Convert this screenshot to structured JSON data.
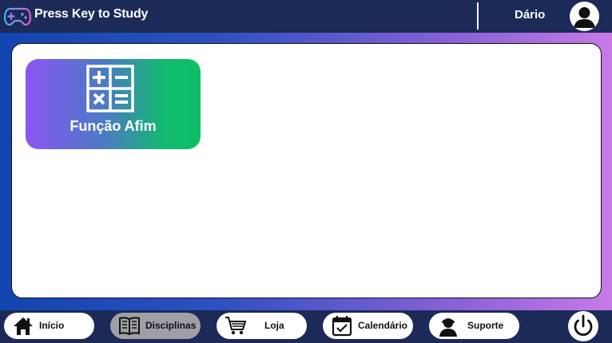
{
  "header": {
    "app_title": "Press Key to Study",
    "logo_icon": "gamepad-icon",
    "user_name": "Dário",
    "avatar_icon": "user-avatar-icon"
  },
  "content": {
    "subjects": [
      {
        "label": "Função Afim",
        "icon": "math-operators-icon"
      }
    ]
  },
  "nav": {
    "items": [
      {
        "label": "Início",
        "icon": "home-icon"
      },
      {
        "label": "Disciplinas",
        "icon": "book-icon",
        "active": true
      },
      {
        "label": "Loja",
        "icon": "cart-icon"
      },
      {
        "label": "Calendário",
        "icon": "calendar-icon"
      },
      {
        "label": "Suporte",
        "icon": "support-agent-icon"
      }
    ],
    "power_icon": "power-icon"
  },
  "colors": {
    "header_bg": "#1b2a57",
    "gradient_start": "#1145b0",
    "gradient_end": "#c77ae6",
    "card_gradient_start": "#8a56f3",
    "card_gradient_end": "#0dbd66",
    "active_nav_bg": "#9f9fa6"
  }
}
